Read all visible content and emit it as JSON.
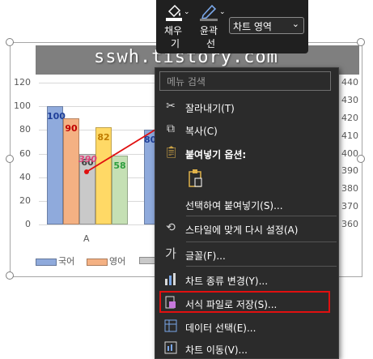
{
  "watermark": "sswh.tistory.com",
  "ribbon": {
    "fill_label_1": "채우",
    "fill_label_2": "기",
    "outline_label_1": "윤곽",
    "outline_label_2": "선",
    "chart_area_value": "차트 영역"
  },
  "menu": {
    "search_placeholder": "메뉴 검색",
    "items": [
      {
        "label": "잘라내기(T)",
        "icon": "scissors-icon"
      },
      {
        "label": "복사(C)",
        "icon": "copy-icon"
      },
      {
        "label": "붙여넣기 옵션:",
        "icon": "paste-icon"
      },
      {
        "label": "",
        "icon": "paste-option-icon"
      },
      {
        "label": "선택하여 붙여넣기(S)...",
        "icon": ""
      },
      {
        "label": "스타일에 맞게 다시 설정(A)",
        "icon": "reset-style-icon"
      },
      {
        "label": "글꼴(F)...",
        "icon": "font-icon"
      },
      {
        "label": "차트 종류 변경(Y)...",
        "icon": "chart-type-icon"
      },
      {
        "label": "서식 파일로 저장(S)...",
        "icon": "save-template-icon"
      },
      {
        "label": "데이터 선택(E)...",
        "icon": "select-data-icon"
      },
      {
        "label": "차트 이동(V)...",
        "icon": "move-chart-icon"
      }
    ]
  },
  "chart_data": {
    "type": "bar",
    "categories": [
      "A"
    ],
    "series": [
      {
        "name": "국어",
        "values": [
          100
        ],
        "color": "#8faadc",
        "label_color": "#1f3f99"
      },
      {
        "name": "영어",
        "values": [
          90
        ],
        "color": "#f4b183",
        "label_color": "#c00000"
      },
      {
        "name": "",
        "values": [
          60
        ],
        "color": "#c9c9c9",
        "label_color": "#404040"
      },
      {
        "name": "",
        "values": [
          82
        ],
        "color": "#ffd966",
        "label_color": "#bf7b00"
      },
      {
        "name": "",
        "values": [
          58
        ],
        "color": "#c5e0b4",
        "label_color": "#2e9e3e"
      }
    ],
    "partial_bar_value": 80,
    "line_point_label": "390",
    "line_color": "#e01010",
    "ylim": [
      0,
      120
    ],
    "yticks": [
      "120",
      "100",
      "80",
      "60",
      "40",
      "20",
      "0"
    ],
    "y2ticks": [
      "440",
      "430",
      "420",
      "410",
      "400",
      "390",
      "380",
      "370",
      "360"
    ],
    "y2lim": [
      360,
      440
    ]
  }
}
